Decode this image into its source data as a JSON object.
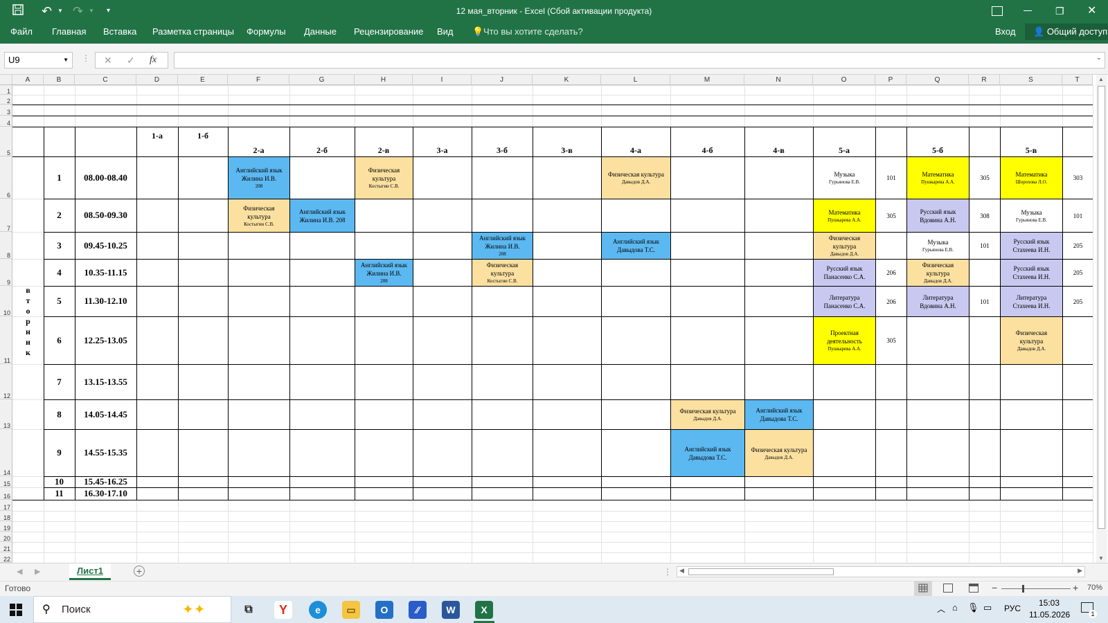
{
  "window": {
    "title": "12 мая_вторник - Excel (Сбой активации продукта)",
    "signin": "Вход",
    "share": "Общий доступ"
  },
  "tabs": [
    "Файл",
    "Главная",
    "Вставка",
    "Разметка страницы",
    "Формулы",
    "Данные",
    "Рецензирование",
    "Вид",
    "Что вы хотите сделать?"
  ],
  "formula_bar": {
    "name_box": "U9",
    "fx": "fx",
    "cancel": "✕",
    "enter": "✓",
    "value": ""
  },
  "columns": [
    "A",
    "B",
    "C",
    "D",
    "E",
    "F",
    "G",
    "H",
    "I",
    "J",
    "K",
    "L",
    "M",
    "N",
    "O",
    "P",
    "Q",
    "R",
    "S",
    "T"
  ],
  "rows": [
    "1",
    "2",
    "3",
    "4",
    "5",
    "6",
    "7",
    "8",
    "9",
    "10",
    "11",
    "12",
    "13",
    "14",
    "15",
    "16",
    "17",
    "18",
    "19",
    "20",
    "21",
    "22"
  ],
  "classes": [
    "1-а",
    "1-б",
    "2-а",
    "2-б",
    "2-в",
    "3-а",
    "3-б",
    "3-в",
    "4-а",
    "4-б",
    "4-в",
    "5-а",
    "5-б",
    "5-в"
  ],
  "day_label": [
    "в",
    "т",
    "о",
    "р",
    "н",
    "и",
    "к"
  ],
  "lessons": [
    {
      "n": "1",
      "time": "08.00-08.40"
    },
    {
      "n": "2",
      "time": "08.50-09.30"
    },
    {
      "n": "3",
      "time": "09.45-10.25"
    },
    {
      "n": "4",
      "time": "10.35-11.15"
    },
    {
      "n": "5",
      "time": "11.30-12.10"
    },
    {
      "n": "6",
      "time": "12.25-13.05"
    },
    {
      "n": "7",
      "time": "13.15-13.55"
    },
    {
      "n": "8",
      "time": "14.05-14.45"
    },
    {
      "n": "9",
      "time": "14.55-15.35"
    },
    {
      "n": "10",
      "time": "15.45-16.25"
    },
    {
      "n": "11",
      "time": "16.30-17.10"
    }
  ],
  "cells": [
    {
      "row": 0,
      "col": "F",
      "color": "#5cb8f0",
      "lines": [
        "Английский язык",
        "Жилина И.В.",
        "208"
      ]
    },
    {
      "row": 0,
      "col": "H",
      "color": "#fbe0a0",
      "lines": [
        "Физическая",
        "культура",
        "Костыгин С.В."
      ]
    },
    {
      "row": 0,
      "col": "L",
      "color": "#fbe0a0",
      "lines": [
        "Физическая культура",
        "Давыдов Д.А."
      ]
    },
    {
      "row": 0,
      "col": "O",
      "color": "#ffffff",
      "lines": [
        "Музыка",
        "Гурьянова Е.В."
      ]
    },
    {
      "row": 0,
      "col": "P",
      "color": "#ffffff",
      "lines": [
        "101"
      ]
    },
    {
      "row": 0,
      "col": "Q",
      "color": "#ffff00",
      "lines": [
        "Математика",
        "Пушкарева А.А."
      ]
    },
    {
      "row": 0,
      "col": "R",
      "color": "#ffffff",
      "lines": [
        "305"
      ]
    },
    {
      "row": 0,
      "col": "S",
      "color": "#ffff00",
      "lines": [
        "Математика",
        "Шорохова Л.О."
      ]
    },
    {
      "row": 0,
      "col": "T",
      "color": "#ffffff",
      "lines": [
        "303"
      ]
    },
    {
      "row": 1,
      "col": "F",
      "color": "#fbe0a0",
      "lines": [
        "Физическая",
        "культура",
        "Костыгин С.В."
      ]
    },
    {
      "row": 1,
      "col": "G",
      "color": "#5cb8f0",
      "lines": [
        "Английский язык",
        "Жилина И.В.      208"
      ]
    },
    {
      "row": 1,
      "col": "O",
      "color": "#ffff00",
      "lines": [
        "Математика",
        "Пушкарева А.А."
      ]
    },
    {
      "row": 1,
      "col": "P",
      "color": "#ffffff",
      "lines": [
        "305"
      ]
    },
    {
      "row": 1,
      "col": "Q",
      "color": "#c8c8f0",
      "lines": [
        "Русский язык",
        "Вдовина А.Н."
      ]
    },
    {
      "row": 1,
      "col": "R",
      "color": "#ffffff",
      "lines": [
        "308"
      ]
    },
    {
      "row": 1,
      "col": "S",
      "color": "#ffffff",
      "lines": [
        "Музыка",
        "Гурьянова Е.В."
      ]
    },
    {
      "row": 1,
      "col": "T",
      "color": "#ffffff",
      "lines": [
        "101"
      ]
    },
    {
      "row": 2,
      "col": "J",
      "color": "#5cb8f0",
      "lines": [
        "Английский язык",
        "Жилина И.В.",
        "208"
      ]
    },
    {
      "row": 2,
      "col": "L",
      "color": "#5cb8f0",
      "lines": [
        "Английский язык",
        "Давыдова Т.С."
      ]
    },
    {
      "row": 2,
      "col": "O",
      "color": "#fbe0a0",
      "lines": [
        "Физическая",
        "культура",
        "Давыдов Д.А."
      ]
    },
    {
      "row": 2,
      "col": "Q",
      "color": "#ffffff",
      "lines": [
        "Музыка",
        "Гурьянова Е.В."
      ]
    },
    {
      "row": 2,
      "col": "R",
      "color": "#ffffff",
      "lines": [
        "101"
      ]
    },
    {
      "row": 2,
      "col": "S",
      "color": "#c8c8f0",
      "lines": [
        "Русский язык",
        "Стахеева И.Н."
      ]
    },
    {
      "row": 2,
      "col": "T",
      "color": "#ffffff",
      "lines": [
        "205"
      ]
    },
    {
      "row": 3,
      "col": "H",
      "color": "#5cb8f0",
      "lines": [
        "Английский язык",
        "Жилина И.В.",
        "208"
      ]
    },
    {
      "row": 3,
      "col": "J",
      "color": "#fbe0a0",
      "lines": [
        "Физическая",
        "культура",
        "Костыгин С.В."
      ]
    },
    {
      "row": 3,
      "col": "O",
      "color": "#c8c8f0",
      "lines": [
        "Русский язык",
        "Панасенко С.А."
      ]
    },
    {
      "row": 3,
      "col": "P",
      "color": "#ffffff",
      "lines": [
        "206"
      ]
    },
    {
      "row": 3,
      "col": "Q",
      "color": "#fbe0a0",
      "lines": [
        "Физическая",
        "культура",
        "Давыдов Д.А."
      ]
    },
    {
      "row": 3,
      "col": "S",
      "color": "#c8c8f0",
      "lines": [
        "Русский язык",
        "Стахеева И.Н."
      ]
    },
    {
      "row": 3,
      "col": "T",
      "color": "#ffffff",
      "lines": [
        "205"
      ]
    },
    {
      "row": 4,
      "col": "O",
      "color": "#c8c8f0",
      "lines": [
        "Литература",
        "Панасенко С.А."
      ]
    },
    {
      "row": 4,
      "col": "P",
      "color": "#ffffff",
      "lines": [
        "206"
      ]
    },
    {
      "row": 4,
      "col": "Q",
      "color": "#c8c8f0",
      "lines": [
        "Литература",
        "Вдовина А.Н."
      ]
    },
    {
      "row": 4,
      "col": "R",
      "color": "#ffffff",
      "lines": [
        "101"
      ]
    },
    {
      "row": 4,
      "col": "S",
      "color": "#c8c8f0",
      "lines": [
        "Литература",
        "Стахеева И.Н."
      ]
    },
    {
      "row": 4,
      "col": "T",
      "color": "#ffffff",
      "lines": [
        "205"
      ]
    },
    {
      "row": 5,
      "col": "O",
      "color": "#ffff00",
      "lines": [
        "Проектная",
        "деятельность",
        "Пушкарева А.А."
      ]
    },
    {
      "row": 5,
      "col": "P",
      "color": "#ffffff",
      "lines": [
        "305"
      ]
    },
    {
      "row": 5,
      "col": "S",
      "color": "#fbe0a0",
      "lines": [
        "Физическая",
        "культура",
        "Давыдов Д.А."
      ]
    },
    {
      "row": 7,
      "col": "M",
      "color": "#fbe0a0",
      "lines": [
        "Физическая культура",
        "Давыдов Д.А."
      ]
    },
    {
      "row": 7,
      "col": "N",
      "color": "#5cb8f0",
      "lines": [
        "Английский язык",
        "Давыдова Т.С."
      ]
    },
    {
      "row": 8,
      "col": "M",
      "color": "#5cb8f0",
      "lines": [
        "Английский язык",
        "Давыдова Т.С."
      ]
    },
    {
      "row": 8,
      "col": "N",
      "color": "#fbe0a0",
      "lines": [
        "Физическая культура",
        "Давыдов Д.А."
      ]
    }
  ],
  "sheet_tab": "Лист1",
  "status": {
    "ready": "Готово",
    "zoom": "70%"
  },
  "taskbar": {
    "search": "Поиск",
    "lang": "РУС",
    "time": "15:03",
    "date": "11.05.2026",
    "notifications": "1"
  }
}
